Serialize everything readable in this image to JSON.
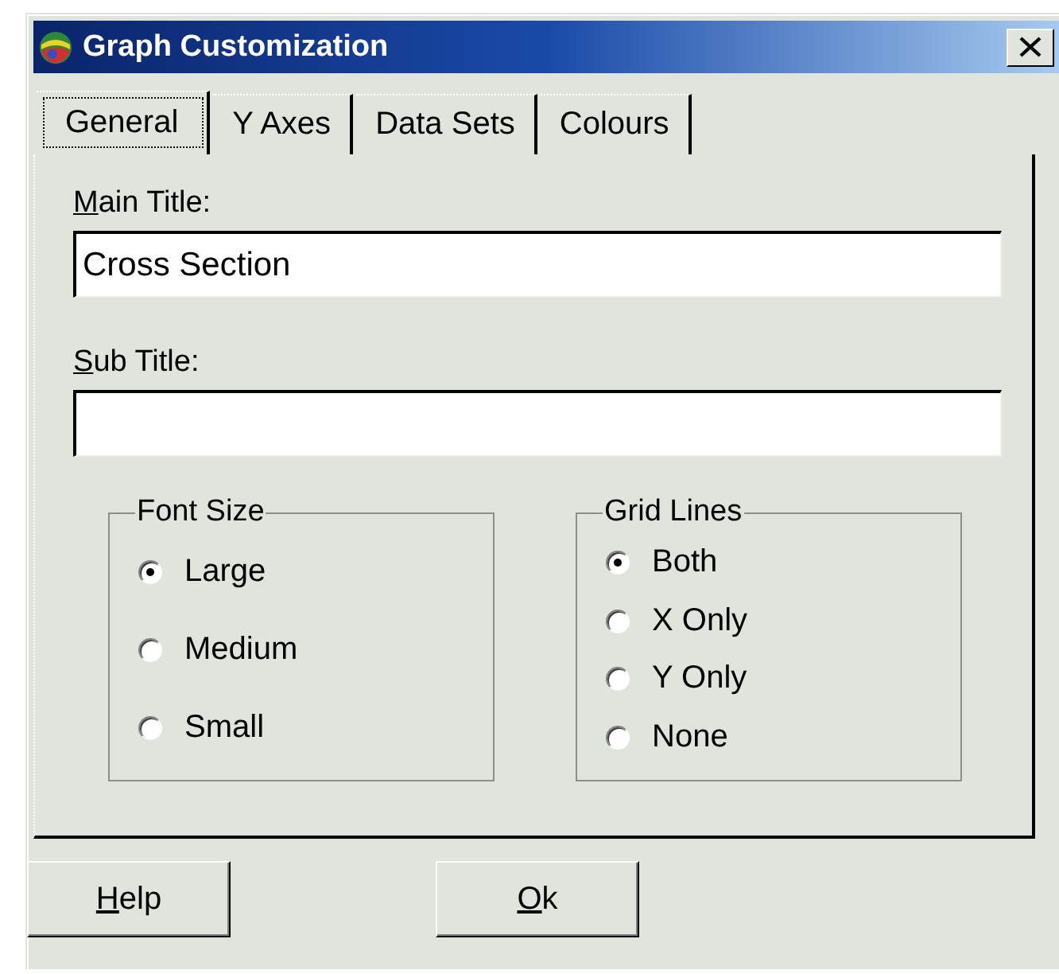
{
  "window": {
    "title": "Graph Customization"
  },
  "tabs": [
    {
      "label": "General",
      "selected": true
    },
    {
      "label": "Y Axes",
      "selected": false
    },
    {
      "label": "Data Sets",
      "selected": false
    },
    {
      "label": "Colours",
      "selected": false
    }
  ],
  "fields": [
    {
      "label": "Main Title:",
      "underline_first": true,
      "value": "Cross Section"
    },
    {
      "label": "Sub Title:",
      "underline_first": true
    }
  ],
  "groups": [
    {
      "title": "Font Size",
      "options": [
        {
          "label": "Large",
          "selected": true
        },
        {
          "label": "Medium",
          "selected": false
        },
        {
          "label": "Small",
          "selected": false
        }
      ]
    },
    {
      "title": "Grid Lines",
      "options": [
        {
          "label": "Both",
          "selected": true
        },
        {
          "label": "X Only",
          "selected": false
        },
        {
          "label": "Y Only",
          "selected": false
        },
        {
          "label": "None",
          "selected": false
        }
      ]
    }
  ],
  "buttons": [
    {
      "label": "Help",
      "underline_first": true
    },
    {
      "label": "Ok",
      "underline_first": true
    }
  ]
}
